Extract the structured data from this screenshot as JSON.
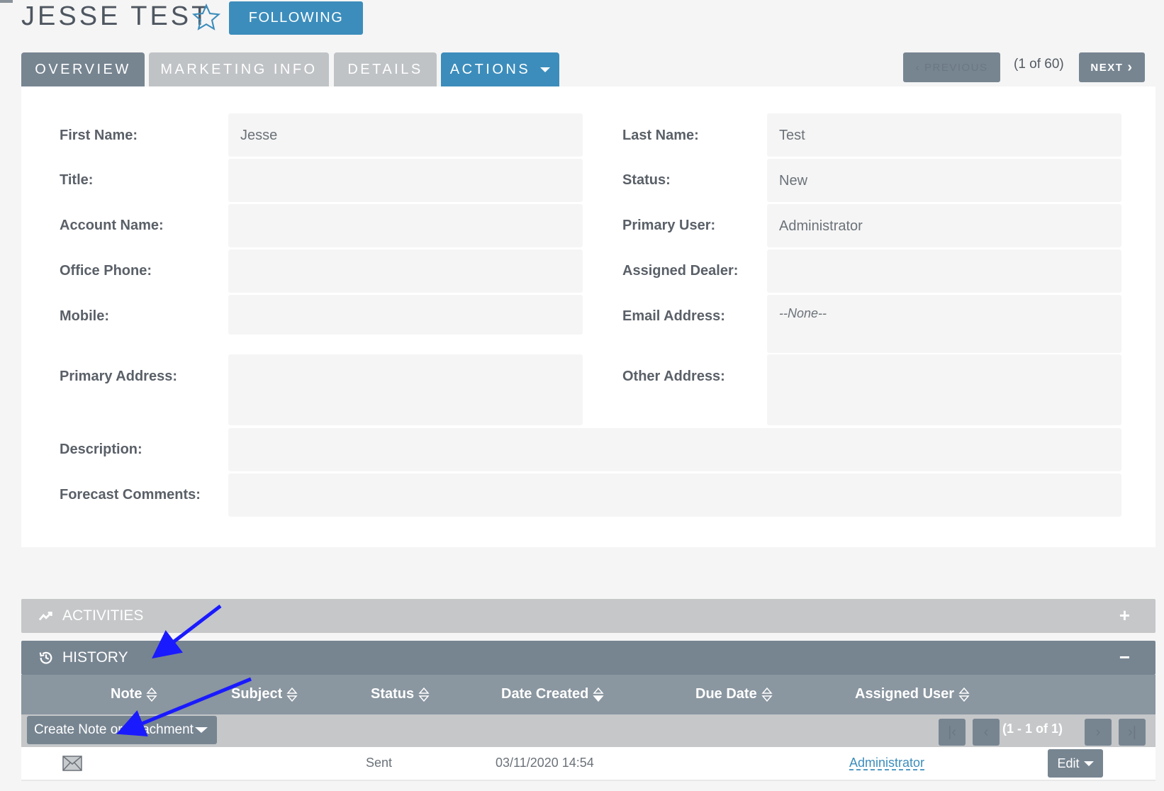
{
  "header": {
    "title": "JESSE TEST",
    "following_label": "FOLLOWING"
  },
  "tabs": [
    {
      "label": "OVERVIEW"
    },
    {
      "label": "MARKETING INFO"
    },
    {
      "label": "DETAILS"
    },
    {
      "label": "ACTIONS"
    }
  ],
  "record_nav": {
    "previous_label": "PREVIOUS",
    "counter": "(1 of 60)",
    "next_label": "NEXT"
  },
  "fields": {
    "first_name": {
      "label": "First Name:",
      "value": "Jesse"
    },
    "last_name": {
      "label": "Last Name:",
      "value": "Test"
    },
    "title": {
      "label": "Title:",
      "value": ""
    },
    "status": {
      "label": "Status:",
      "value": "New"
    },
    "account_name": {
      "label": "Account Name:",
      "value": ""
    },
    "primary_user": {
      "label": "Primary User:",
      "value": "Administrator"
    },
    "office_phone": {
      "label": "Office Phone:",
      "value": ""
    },
    "assigned_dealer": {
      "label": "Assigned Dealer:",
      "value": ""
    },
    "mobile": {
      "label": "Mobile:",
      "value": ""
    },
    "email_address": {
      "label": "Email Address:",
      "value": "--None--"
    },
    "primary_address": {
      "label": "Primary Address:",
      "value": ""
    },
    "other_address": {
      "label": "Other Address:",
      "value": ""
    },
    "description": {
      "label": "Description:",
      "value": ""
    },
    "forecast_comments": {
      "label": "Forecast Comments:",
      "value": ""
    }
  },
  "subpanels": {
    "activities": {
      "title": "ACTIVITIES",
      "toggle": "+"
    },
    "history": {
      "title": "HISTORY",
      "toggle": "−"
    }
  },
  "history_table": {
    "columns": [
      "Note",
      "Subject",
      "Status",
      "Date Created",
      "Due Date",
      "Assigned User"
    ],
    "create_label": "Create Note or Attachment",
    "pagination": "(1 - 1 of 1)",
    "rows": [
      {
        "status": "Sent",
        "date_created": "03/11/2020 14:54",
        "assigned_user": "Administrator",
        "edit_label": "Edit"
      }
    ]
  },
  "colors": {
    "accent": "#3c8dbc",
    "tab_active": "#778591",
    "tab_inactive": "#c0c3c6",
    "annotation_arrow": "#1a1aff"
  }
}
